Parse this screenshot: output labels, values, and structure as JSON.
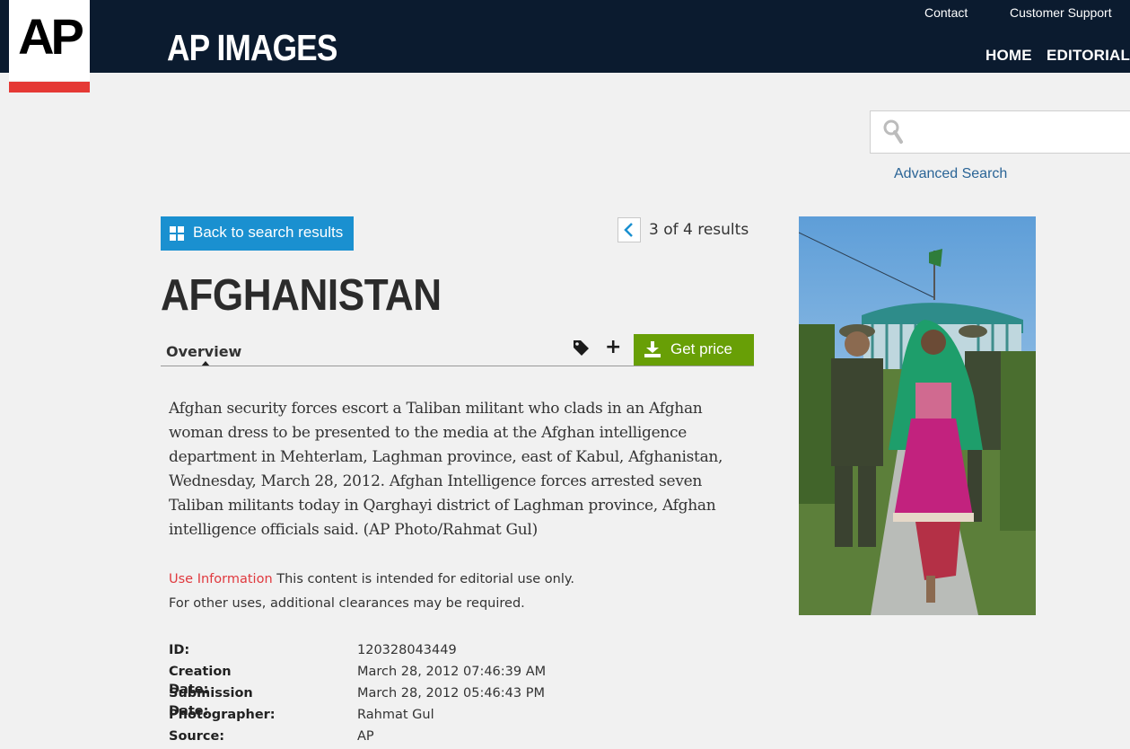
{
  "header": {
    "logo_text": "AP",
    "brand": "AP IMAGES",
    "top_links": {
      "contact": "Contact",
      "support": "Customer Support"
    },
    "nav": {
      "home": "HOME",
      "editorial": "EDITORIAL"
    },
    "colors": {
      "header_bg": "#0b1b2f",
      "logo_bar": "#e53935"
    }
  },
  "search": {
    "placeholder": "",
    "advanced_label": "Advanced Search"
  },
  "results_nav": {
    "back_label": "Back to search results",
    "count_text": "3 of 4 results"
  },
  "article": {
    "title": "AFGHANISTAN",
    "tabs": {
      "overview": "Overview"
    },
    "get_price_label": "Get price",
    "caption": "Afghan security forces escort a Taliban militant who clads in an Afghan woman dress to be presented to the media at the Afghan intelligence department in Mehterlam, Laghman province, east of Kabul, Afghanistan, Wednesday, March 28, 2012. Afghan Intelligence forces arrested seven Taliban militants today in Qarghayi district of Laghman province, Afghan intelligence officials said. (AP Photo/Rahmat Gul)",
    "use_info": {
      "label": "Use Information",
      "text": "This content is intended for editorial use only.",
      "line2": "For other uses, additional clearances may be required."
    },
    "metadata": [
      {
        "key": "ID:",
        "value": "120328043449"
      },
      {
        "key": "Creation Date:",
        "value": "March 28, 2012 07:46:39 AM"
      },
      {
        "key": "Submission Date:",
        "value": "March 28, 2012 05:46:43 PM"
      },
      {
        "key": "Photographer:",
        "value": "Rahmat Gul"
      },
      {
        "key": "Source:",
        "value": "AP"
      }
    ],
    "icons": {
      "tag": "tag-icon",
      "add": "plus-icon",
      "download": "download-icon",
      "grid": "grid-icon",
      "prev": "chevron-left-icon",
      "search": "search-icon"
    },
    "colors": {
      "get_price_bg": "#689f06",
      "back_btn_bg": "#1a90d0",
      "use_info_label": "#e0393e",
      "link": "#2a6496"
    }
  }
}
